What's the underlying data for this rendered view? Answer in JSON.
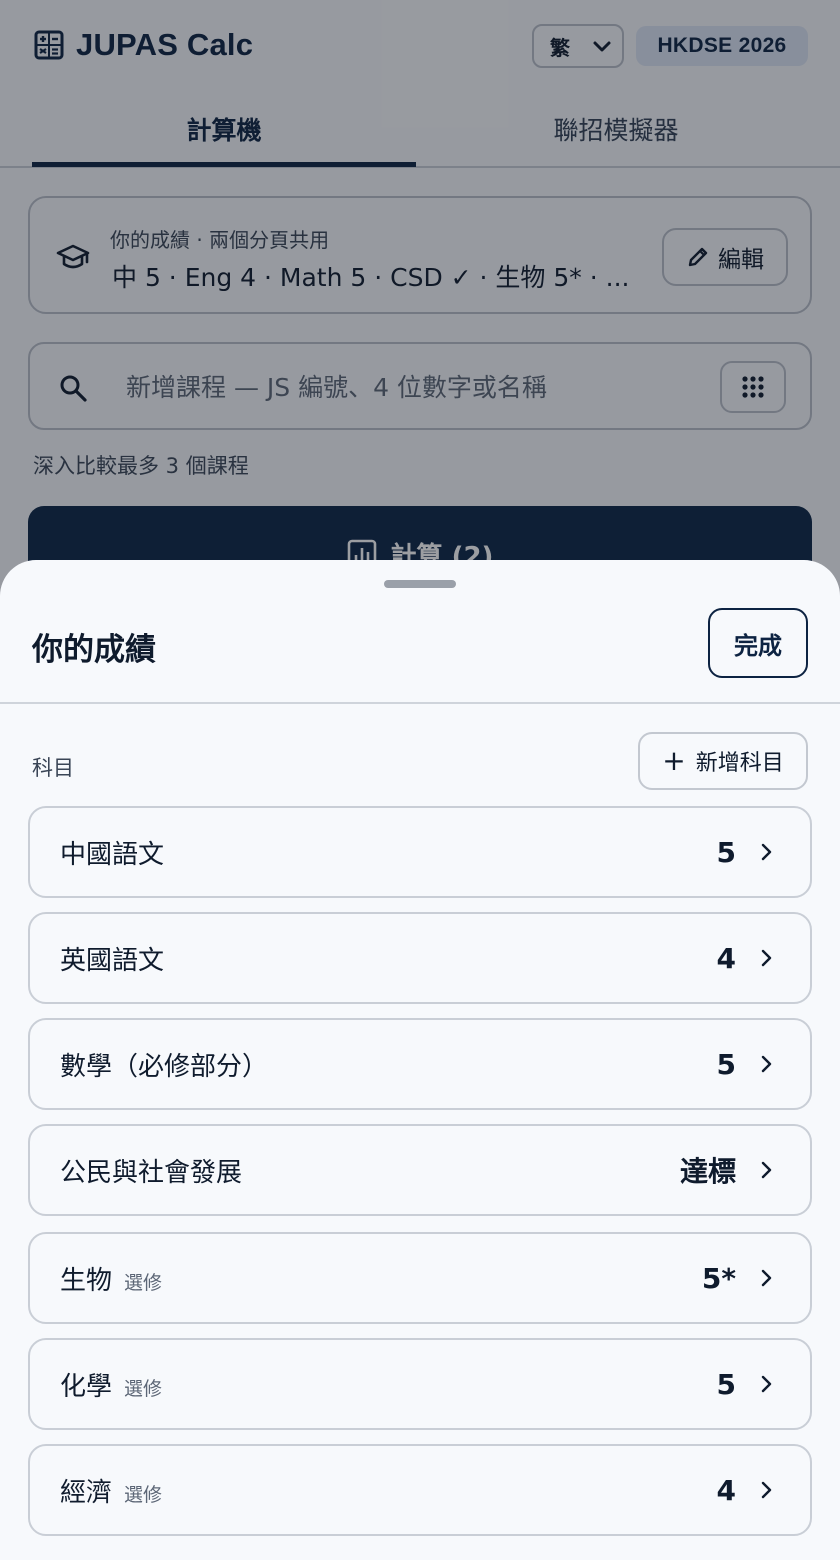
{
  "app": {
    "title": "JUPAS Calc",
    "language": "繁",
    "year_badge": "HKDSE 2026"
  },
  "tabs": [
    {
      "label": "計算機",
      "active": true
    },
    {
      "label": "聯招模擬器",
      "active": false
    }
  ],
  "scores_card": {
    "subtitle": "你的成績 · 兩個分頁共用",
    "summary": "中 5 · Eng 4 · Math 5 · CSD ✓ · 生物 5* · ...",
    "edit_label": "編輯"
  },
  "search": {
    "placeholder": "新增課程 — JS 編號、4 位數字或名稱",
    "value": ""
  },
  "compare_note": "深入比較最多 3 個課程",
  "calculate_label": "計算 (2)",
  "sheet": {
    "title": "你的成績",
    "done_label": "完成",
    "subjects_label": "科目",
    "add_subject_label": "新增科目",
    "subjects": [
      {
        "name": "中國語文",
        "tag": "",
        "grade": "5"
      },
      {
        "name": "英國語文",
        "tag": "",
        "grade": "4"
      },
      {
        "name": "數學（必修部分）",
        "tag": "",
        "grade": "5"
      },
      {
        "name": "公民與社會發展",
        "tag": "",
        "grade": "達標"
      },
      {
        "name": "生物",
        "tag": "選修",
        "grade": "5*"
      },
      {
        "name": "化學",
        "tag": "選修",
        "grade": "5"
      },
      {
        "name": "經濟",
        "tag": "選修",
        "grade": "4"
      }
    ]
  },
  "colors": {
    "primary": "#0d2342",
    "badge_bg": "#dce5f4",
    "border": "#b8bec8",
    "background": "#f7f9fc"
  },
  "icons": {
    "brand": "calculator-icon",
    "scores": "graduation-cap-icon",
    "edit": "pencil-icon",
    "search": "search-icon",
    "grid": "grid-dots-icon",
    "calculate": "bar-chart-icon",
    "row": "chevron-right-icon"
  }
}
